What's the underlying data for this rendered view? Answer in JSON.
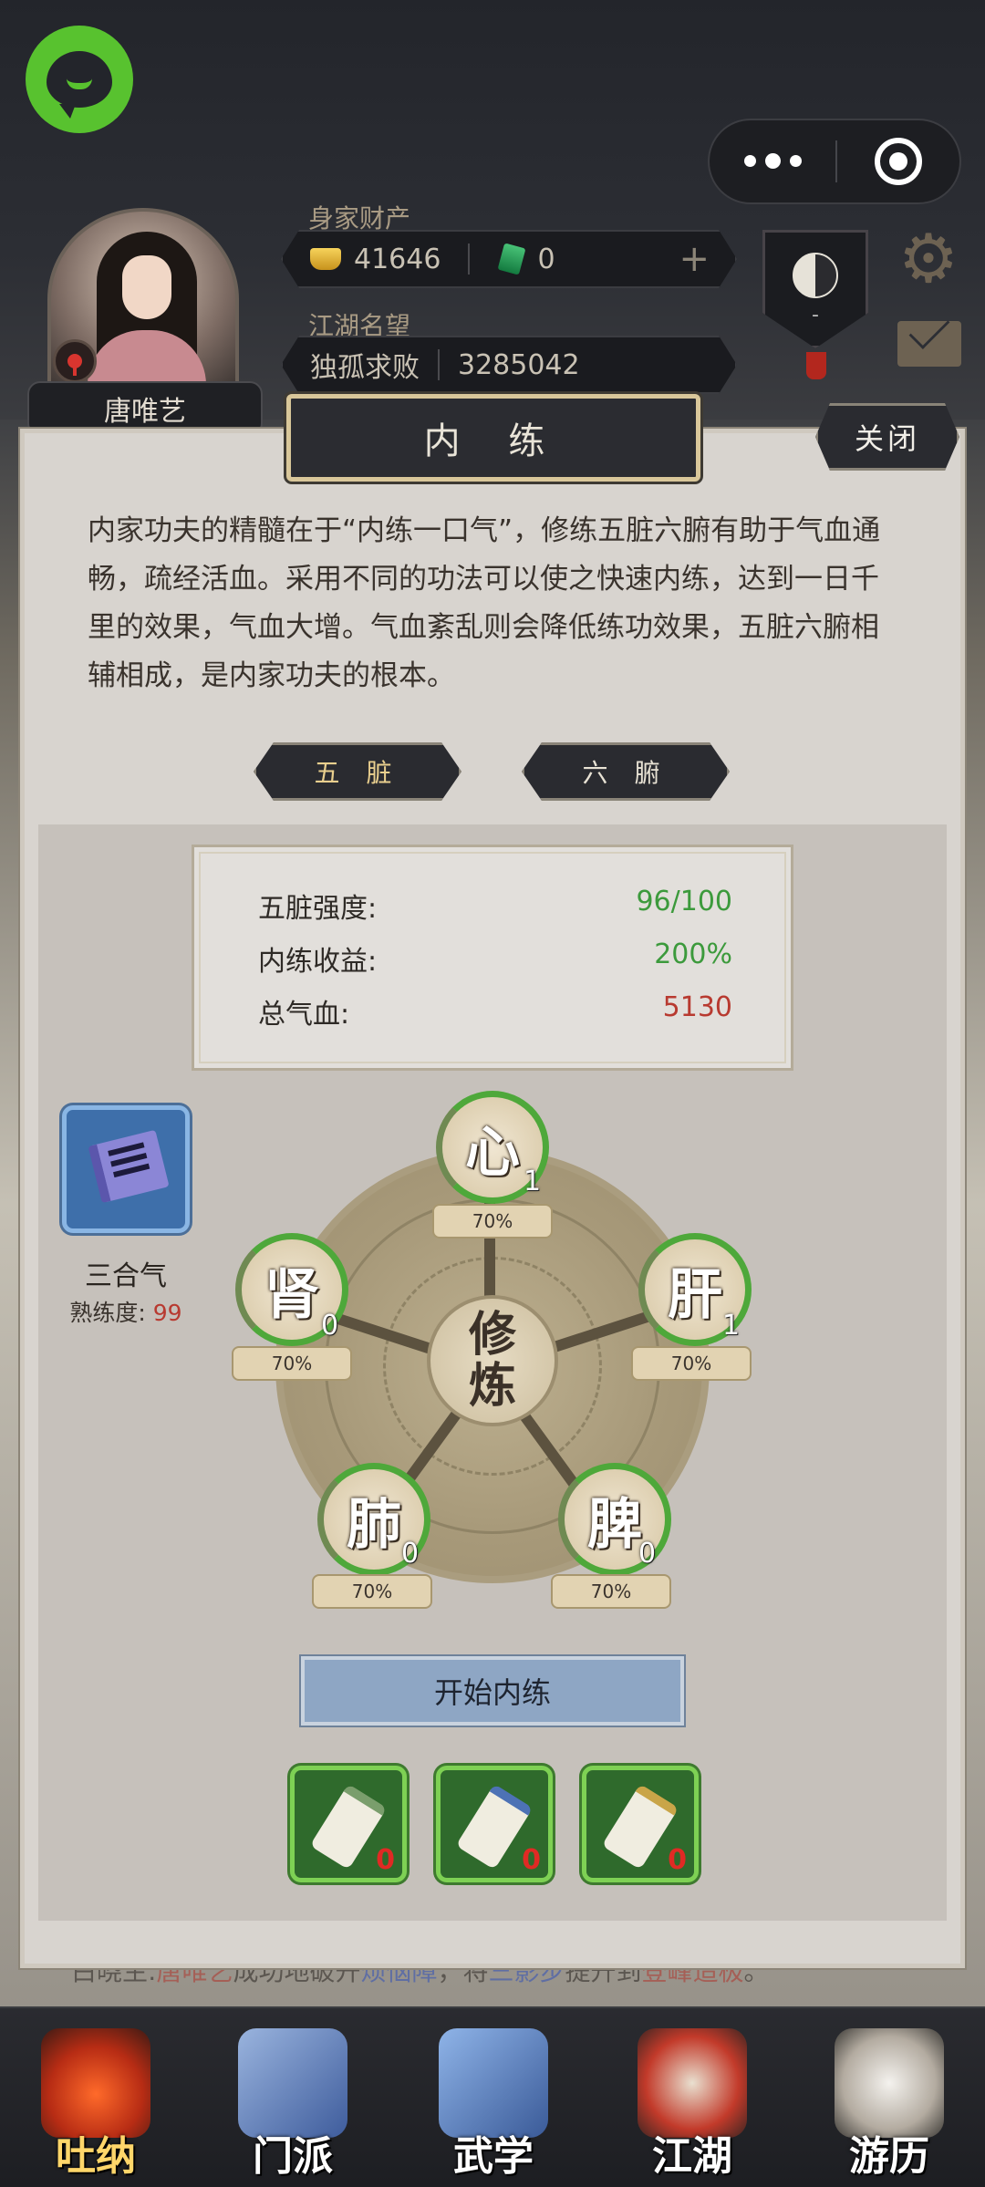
{
  "header": {
    "player_name": "唐唯艺",
    "wealth_label": "身家财产",
    "gold_amount": "41646",
    "jade_amount": "0",
    "plus_symbol": "+",
    "fame_label": "江湖名望",
    "fame_title": "独孤求败",
    "fame_value": "3285042",
    "badge_dash": "-"
  },
  "dialog": {
    "title": "内 练",
    "close_label": "关闭",
    "intro": "内家功夫的精髓在于“内练一口气”，修练五脏六腑有助于气血通畅，疏经活血。采用不同的功法可以使之快速内练，达到一日千里的效果，气血大增。气血紊乱则会降低练功效果，五脏六腑相辅相成，是内家功夫的根本。",
    "tabs": [
      {
        "label": "五 脏",
        "selected": true
      },
      {
        "label": "六 腑",
        "selected": false
      }
    ],
    "stats": [
      {
        "label": "五脏强度:",
        "value": "96/100",
        "color": "#3c9a3c"
      },
      {
        "label": "内练收益:",
        "value": "200%",
        "color": "#3c9a3c"
      },
      {
        "label": "总气血:",
        "value": "5130",
        "color": "#b83a30"
      }
    ],
    "skill": {
      "name": "三合气",
      "prof_label": "熟练度:",
      "prof_value": "99"
    },
    "center_label_1": "修",
    "center_label_2": "炼",
    "organs": [
      {
        "name": "心",
        "level": "1",
        "percent": "70%"
      },
      {
        "name": "肝",
        "level": "1",
        "percent": "70%"
      },
      {
        "name": "脾",
        "level": "0",
        "percent": "70%"
      },
      {
        "name": "肺",
        "level": "0",
        "percent": "70%"
      },
      {
        "name": "肾",
        "level": "0",
        "percent": "70%"
      }
    ],
    "start_button": "开始内练",
    "items": [
      {
        "count": "0"
      },
      {
        "count": "0"
      },
      {
        "count": "0"
      }
    ]
  },
  "news": {
    "speaker": "白晓生:",
    "name": "唐唯艺",
    "text1": "成功地破开",
    "item1": "烦恼障",
    "text2": "，将",
    "skill": "三影步",
    "text3": "提升到",
    "level": "登峰造极",
    "end": "。"
  },
  "bottom_nav": [
    {
      "label": "吐纳"
    },
    {
      "label": "门派"
    },
    {
      "label": "武学"
    },
    {
      "label": "江湖"
    },
    {
      "label": "游历"
    }
  ],
  "colors": {
    "accent_green": "#58c22f",
    "value_green": "#3c9a3c",
    "value_red": "#b83a30",
    "start_button_blue": "#8ea6c4"
  },
  "icons": {
    "app_logo": "chat-bubble-icon",
    "capsule_menu": "more-dots-icon",
    "capsule_close": "target-circle-icon",
    "settings": "gear-icon",
    "mail": "mail-icon",
    "rank": "yinyang-icon"
  }
}
